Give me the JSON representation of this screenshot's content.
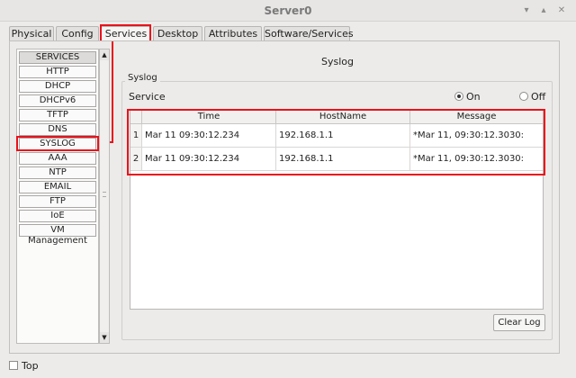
{
  "window": {
    "title": "Server0",
    "minimize_glyph": "▾",
    "maximize_glyph": "▴",
    "close_glyph": "✕"
  },
  "tabs": [
    {
      "label": "Physical"
    },
    {
      "label": "Config"
    },
    {
      "label": "Services",
      "selected": true
    },
    {
      "label": "Desktop"
    },
    {
      "label": "Attributes"
    },
    {
      "label": "Software/Services"
    }
  ],
  "services": {
    "header": "SERVICES",
    "items": [
      "HTTP",
      "DHCP",
      "DHCPv6",
      "TFTP",
      "DNS",
      "SYSLOG",
      "AAA",
      "NTP",
      "EMAIL",
      "FTP",
      "IoE",
      "VM Management"
    ],
    "selected": "SYSLOG"
  },
  "syslog": {
    "page_title": "Syslog",
    "group_label": "Syslog",
    "service_label": "Service",
    "on_label": "On",
    "off_label": "Off",
    "service_state": "On",
    "columns": [
      "",
      "Time",
      "HostName",
      "Message"
    ],
    "rows": [
      {
        "index": "1",
        "time": "Mar 11 09:30:12.234",
        "host": "192.168.1.1",
        "message": "*Mar 11, 09:30:12.3030:"
      },
      {
        "index": "2",
        "time": "Mar 11 09:30:12.234",
        "host": "192.168.1.1",
        "message": "*Mar 11, 09:30:12.3030:"
      }
    ],
    "clear_button": "Clear Log"
  },
  "footer": {
    "top_label": "Top",
    "top_checked": false
  },
  "colors": {
    "highlight": "#e8121b",
    "background": "#ecebe9"
  },
  "icons": [
    "minimize-icon",
    "maximize-icon",
    "close-icon",
    "scroll-up-icon",
    "scroll-down-icon"
  ]
}
